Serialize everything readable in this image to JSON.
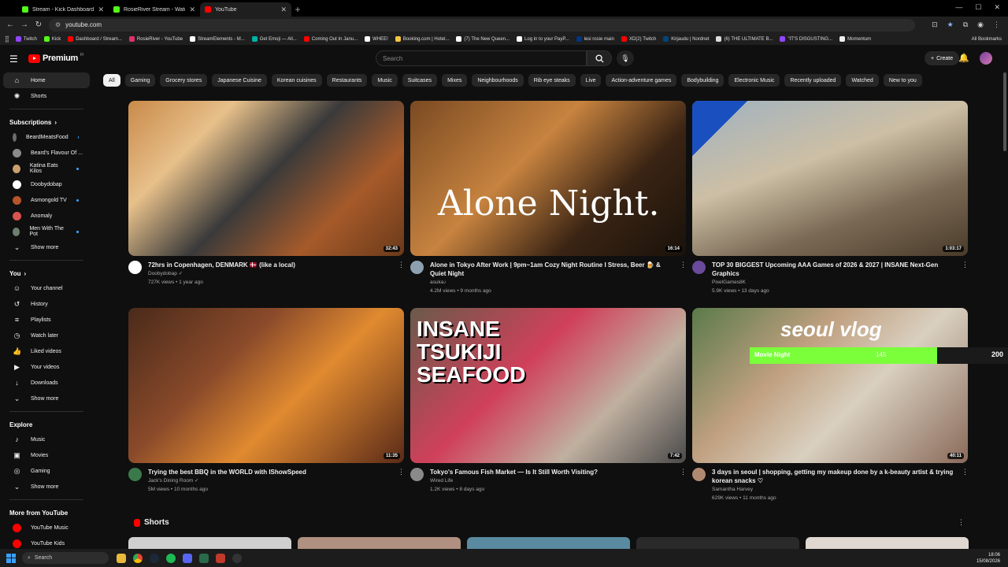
{
  "browser": {
    "tabs": [
      {
        "title": "Stream - Kick Dashboard",
        "color": "#53fc18",
        "active": false
      },
      {
        "title": "RosieRiver Stream - Watch Live",
        "color": "#53fc18",
        "active": false
      },
      {
        "title": "YouTube",
        "color": "#ff0000",
        "active": true
      }
    ],
    "url": "youtube.com",
    "bookmarks": [
      "Twitch",
      "Kick",
      "Dashboard / Stream...",
      "RosieRiver - YouTube",
      "StreamElements - M...",
      "Get Emoji — All...",
      "Coming Out In Janu...",
      "WHEE!",
      "Booking.com | Hotel...",
      "(7) The New Queen...",
      "Log in to your PayP...",
      "lesi rosie main",
      "XD(2) Twitch",
      "Kirjaudu | Nordnet",
      "(6) THE ULTIMATE B...",
      "\"IT'S DISGUSTING...",
      "Momentum"
    ],
    "all_bookmarks": "All Bookmarks"
  },
  "header": {
    "logo": "Premium",
    "logo_region": "FI",
    "search_placeholder": "Search",
    "create_label": "Create"
  },
  "sidebar": {
    "main": [
      {
        "label": "Home",
        "icon": "home-icon",
        "glyph": "⌂",
        "active": true
      },
      {
        "label": "Shorts",
        "icon": "shorts-icon",
        "glyph": "✺",
        "active": false
      }
    ],
    "subscriptions_title": "Subscriptions",
    "subscriptions": [
      {
        "label": "BeardMeatsFood",
        "color": "#6b6b6b",
        "dot": true
      },
      {
        "label": "Beard's Flavour Of ...",
        "color": "#8a8a8a",
        "dot": false
      },
      {
        "label": "Katina Eats Kilos",
        "color": "#c9a06e",
        "dot": true
      },
      {
        "label": "Doobydobap",
        "color": "#ffffff",
        "dot": false
      },
      {
        "label": "Asmongold TV",
        "color": "#b8542a",
        "dot": true
      },
      {
        "label": "Anomaly",
        "color": "#d9534f",
        "dot": false
      },
      {
        "label": "Men With The Pot",
        "color": "#6f7f6f",
        "dot": true
      }
    ],
    "show_more": "Show more",
    "you_title": "You",
    "you": [
      {
        "label": "Your channel",
        "glyph": "☺",
        "icon": "your-channel-icon"
      },
      {
        "label": "History",
        "glyph": "↺",
        "icon": "history-icon"
      },
      {
        "label": "Playlists",
        "glyph": "≡",
        "icon": "playlists-icon"
      },
      {
        "label": "Watch later",
        "glyph": "◷",
        "icon": "watch-later-icon"
      },
      {
        "label": "Liked videos",
        "glyph": "👍",
        "icon": "liked-icon"
      },
      {
        "label": "Your videos",
        "glyph": "▶",
        "icon": "your-videos-icon"
      },
      {
        "label": "Downloads",
        "glyph": "↓",
        "icon": "downloads-icon"
      }
    ],
    "explore_title": "Explore",
    "explore": [
      {
        "label": "Music",
        "glyph": "♪",
        "icon": "music-icon"
      },
      {
        "label": "Movies",
        "glyph": "▣",
        "icon": "movies-icon"
      },
      {
        "label": "Gaming",
        "glyph": "◎",
        "icon": "gaming-icon"
      }
    ],
    "more_title": "More from YouTube",
    "more": [
      {
        "label": "YouTube Music",
        "color": "#ff0000"
      },
      {
        "label": "YouTube Kids",
        "color": "#ff0000"
      }
    ]
  },
  "chips": [
    "All",
    "Gaming",
    "Grocery stores",
    "Japanese Cuisine",
    "Korean cuisines",
    "Restaurants",
    "Music",
    "Suitcases",
    "Mixes",
    "Neighbourhoods",
    "Rib eye steaks",
    "Live",
    "Action-adventure games",
    "Bodybuilding",
    "Electronic Music",
    "Recently uploaded",
    "Watched",
    "New to you"
  ],
  "videos": [
    {
      "title": "72hrs in Copenhagen, DENMARK 🇩🇰 (like a local)",
      "channel": "Doobydobap ✓",
      "stats": "727K views • 1 year ago",
      "duration": "32:43",
      "avatar": "#ffffff",
      "thumb": "linear-gradient(135deg,#c98a4a 0%,#e7c08a 25%,#3a3a3a 50%,#a65a2a 75%,#6a3a1a 100%)",
      "overlay": ""
    },
    {
      "title": "Alone in Tokyo After Work | 9pm~1am Cozy Night Routine I Stress, Beer 🍺 & Quiet Night",
      "channel": "asuka♪",
      "stats": "4.2M views • 9 months ago",
      "duration": "16:14",
      "avatar": "#8da0b0",
      "thumb": "linear-gradient(135deg,#7a4a22 0%,#c7833f 40%,#3a2414 70%,#1a120a 100%)",
      "overlay": "Alone Night."
    },
    {
      "title": "TOP 30 BIGGEST Upcoming AAA Games of 2026 & 2027 | INSANE Next-Gen Graphics",
      "channel": "PixelGames8K",
      "stats": "5.9K views • 13 days ago",
      "duration": "1:03:17",
      "avatar": "#6a4a9a",
      "thumb": "linear-gradient(160deg,#9fb2c0 0%,#cdbfa5 40%,#7a6a55 70%,#4a3a2a 100%)",
      "overlay": ""
    },
    {
      "title": "Trying the best BBQ in the WORLD with IShowSpeed",
      "channel": "Jack's Dining Room ✓",
      "stats": "5M views • 10 months ago",
      "duration": "11:35",
      "avatar": "#3a7a4a",
      "thumb": "linear-gradient(135deg,#4a2a1a 0%,#8a4a2a 35%,#e08a30 60%,#5a2a18 100%)",
      "overlay": ""
    },
    {
      "title": "Tokyo's Famous Fish Market — Is It Still Worth Visiting?",
      "channel": "Wired Life",
      "stats": "1.2K views • 8 days ago",
      "duration": "7:42",
      "avatar": "#8a8a8a",
      "thumb": "linear-gradient(135deg,#6a5a4a 0%,#d0405a 40%,#c0b0a0 70%,#4a4a4a 100%)",
      "overlay": "INSANE TSUKIJI SEAFOOD"
    },
    {
      "title": "3 days in seoul | shopping, getting my makeup done by a k-beauty artist & trying korean snacks ♡",
      "channel": "Samantha Harvey",
      "stats": "629K views • 11 months ago",
      "duration": "40:11",
      "avatar": "#b08a70",
      "thumb": "linear-gradient(135deg,#5a7a4a 0%,#c0a080 35%,#d9d0c0 60%,#8a6a5a 100%)",
      "overlay": "seoul vlog"
    }
  ],
  "movie_night": {
    "label": "Movie Night",
    "value": "145",
    "max": "200",
    "fraction": 0.725
  },
  "shorts_title": "Shorts",
  "taskbar": {
    "search": "Search",
    "time": "18:06",
    "date": "15/08/2026"
  }
}
